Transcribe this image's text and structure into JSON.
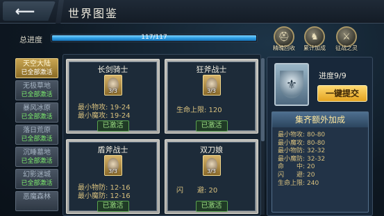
{
  "header": {
    "title": "世界图鉴",
    "back_icon": "back-arrow-icon"
  },
  "progress": {
    "label": "总进度",
    "text": "117/117",
    "fraction": 1.0
  },
  "rewards": [
    {
      "label": "精魄回收",
      "icon": "helmet-icon"
    },
    {
      "label": "累计加成",
      "icon": "knight-icon"
    },
    {
      "label": "征战之灵",
      "icon": "swords-icon"
    }
  ],
  "sidebar": {
    "items": [
      {
        "name": "天空大陆",
        "status": "已全部激活",
        "active": true
      },
      {
        "name": "无极草地",
        "status": "已全部激活",
        "active": false
      },
      {
        "name": "暴风冰原",
        "status": "已全部激活",
        "active": false
      },
      {
        "name": "落日荒原",
        "status": "已全部激活",
        "active": false
      },
      {
        "name": "沉睡墓地",
        "status": "已全部激活",
        "active": false
      },
      {
        "name": "幻影迷城",
        "status": "已全部激活",
        "active": false
      },
      {
        "name": "恶魔森林",
        "status": "",
        "active": false
      }
    ]
  },
  "cards": [
    {
      "name": "长剑骑士",
      "count": "3/3",
      "stats": [
        "最小物攻: 19-24",
        "最小魔攻: 19-24"
      ],
      "button": "已激活"
    },
    {
      "name": "狂斧战士",
      "count": "3/3",
      "stats": [
        "生命上限: 120"
      ],
      "button": "已激活"
    },
    {
      "name": "盾斧战士",
      "count": "3/3",
      "stats": [
        "最小物防: 12-16",
        "最小魔防: 12-16"
      ],
      "button": "已激活"
    },
    {
      "name": "双刀娘",
      "count": "3/3",
      "stats": [
        "闪　　避: 20"
      ],
      "button": "已激活"
    }
  ],
  "set": {
    "progress": "进度9/9",
    "submit_label": "一键提交",
    "bonus_title": "集齐额外加成",
    "bonus": [
      {
        "k": "最小物攻:",
        "v": "80-80"
      },
      {
        "k": "最小魔攻:",
        "v": "80-80"
      },
      {
        "k": "最小物防:",
        "v": "32-32"
      },
      {
        "k": "最小魔防:",
        "v": "32-32"
      },
      {
        "k": "命　　中:",
        "v": "20"
      },
      {
        "k": "闪　　避:",
        "v": "20"
      },
      {
        "k": "生命上限:",
        "v": "240"
      }
    ]
  }
}
